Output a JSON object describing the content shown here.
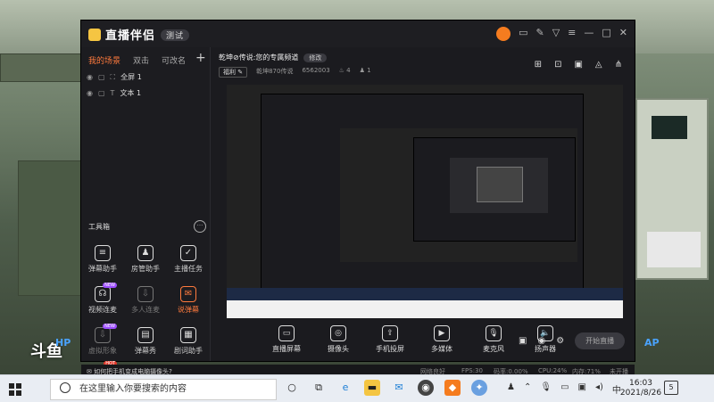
{
  "app": {
    "name": "直播伴侣",
    "version_badge": "测试"
  },
  "sidebar": {
    "tabs": [
      "我的场景",
      "双击",
      "可改名"
    ],
    "scenes": [
      {
        "label": "全屏 1"
      },
      {
        "label": "文本 1"
      }
    ],
    "tools_title": "工具箱",
    "tools": [
      {
        "label": "弹幕助手",
        "icon": "danmaku-assistant-icon"
      },
      {
        "label": "房管助手",
        "icon": "room-admin-icon"
      },
      {
        "label": "主播任务",
        "icon": "streamer-task-icon"
      },
      {
        "label": "视频连麦",
        "icon": "video-link-icon",
        "badge": "NEW"
      },
      {
        "label": "多人连麦",
        "icon": "multi-link-icon"
      },
      {
        "label": "说弹幕",
        "icon": "speak-danmaku-icon"
      },
      {
        "label": "虚拟形象",
        "icon": "avatar-virtual-icon",
        "badge": "NEW"
      },
      {
        "label": "弹幕秀",
        "icon": "danmaku-show-icon"
      },
      {
        "label": "剧词助手",
        "icon": "script-assistant-icon"
      },
      {
        "label": "",
        "icon": "more-tool-icon",
        "badge": "HOT"
      },
      {
        "label": "",
        "icon": "translate-icon"
      },
      {
        "label": "",
        "icon": "share-tool-icon"
      }
    ]
  },
  "room": {
    "title": "乾坤⊘传说:您的专属频道",
    "edit_label": "修改",
    "category": "福利",
    "streamer": "乾坤870传说",
    "room_id": "6562003",
    "fans": "4",
    "likes": "1"
  },
  "controls": [
    {
      "label": "直播屏幕",
      "icon": "screen-capture-icon"
    },
    {
      "label": "摄像头",
      "icon": "camera-icon"
    },
    {
      "label": "手机投屏",
      "icon": "phone-cast-icon"
    },
    {
      "label": "多媒体",
      "icon": "media-icon"
    },
    {
      "label": "麦克风",
      "icon": "microphone-icon"
    },
    {
      "label": "扬声器",
      "icon": "speaker-icon"
    }
  ],
  "go_live_label": "开始直播",
  "status": {
    "tip": "如何把手机变成电脑摄像头?",
    "network": "网络良好",
    "fps": "FPS:30",
    "bitrate": "码率:0.00%",
    "cpu": "CPU:24%",
    "mem": "内存:71%",
    "live_state": "未开播"
  },
  "taskbar": {
    "search_placeholder": "在这里输入你要搜索的内容",
    "time": "16:03",
    "date": "2021/8/26",
    "notification_count": "5",
    "ime": "中"
  },
  "watermark": "斗鱼",
  "hud": {
    "hp_left": "HP",
    "ap_right": "AP"
  }
}
